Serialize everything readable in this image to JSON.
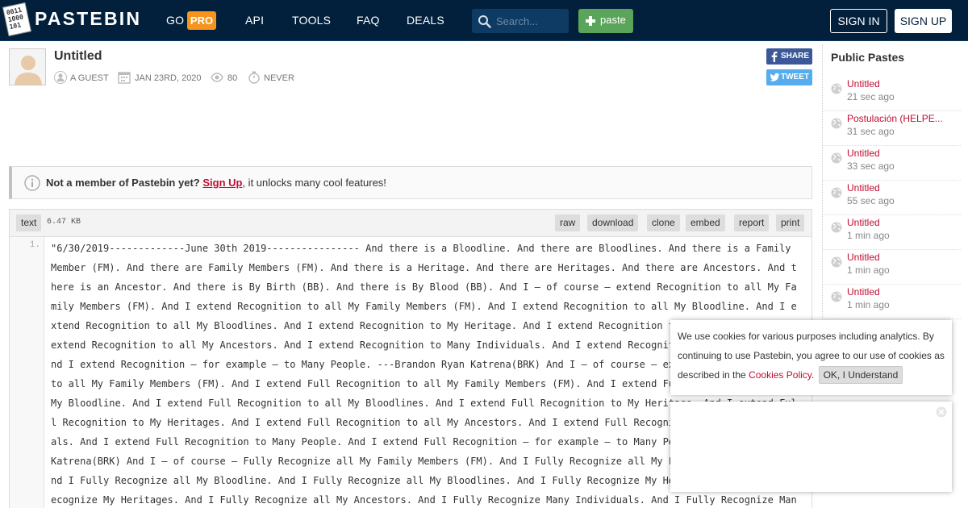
{
  "header": {
    "logo_text": "PASTEBIN",
    "nav": {
      "go": "GO",
      "pro": "PRO",
      "api": "API",
      "tools": "TOOLS",
      "faq": "FAQ",
      "deals": "DEALS"
    },
    "search_placeholder": "Search...",
    "paste_label": "paste",
    "sign_in": "SIGN IN",
    "sign_up": "SIGN UP"
  },
  "paste": {
    "title": "Untitled",
    "author": "A GUEST",
    "date": "JAN 23RD, 2020",
    "views": "80",
    "expiry": "NEVER",
    "share_label": "SHARE",
    "tweet_label": "TWEET"
  },
  "notice": {
    "bold": "Not a member of Pastebin yet?",
    "link": "Sign Up",
    "rest": ", it unlocks many cool features!"
  },
  "code": {
    "syntax": "text",
    "size": "6.47 KB",
    "buttons": {
      "raw": "raw",
      "download": "download",
      "clone": "clone",
      "embed": "embed",
      "report": "report",
      "print": "print"
    },
    "line_number": "1.",
    "content": "\"6/30/2019-------------June 30th 2019---------------- And there is a Bloodline. And there are Bloodlines. And there is a Family Member (FM). And there are Family Members (FM). And there is a Heritage. And there are Heritages. And there are Ancestors. And there is an Ancestor. And there is By Birth (BB). And there is By Blood (BB). And I – of course – extend Recognition to all My Family Members (FM). And I extend Recognition to all My Family Members (FM). And I extend Recognition to all My Bloodline. And I extend Recognition to all My Bloodlines. And I extend Recognition to My Heritage. And I extend Recognition to My Heritages. And I extend Recognition to all My Ancestors. And I extend Recognition to Many Individuals. And I extend Recognition to Many People. And I extend Recognition – for example – to Many People. ---Brandon Ryan Katrena(BRK) And I – of course – extend Full Recognition to all My Family Members (FM). And I extend Full Recognition to all My Family Members (FM). And I extend Full Recognition to all My Bloodline. And I extend Full Recognition to all My Bloodlines. And I extend Full Recognition to My Heritage. And I extend Full Recognition to My Heritages. And I extend Full Recognition to all My Ancestors. And I extend Full Recognition to Many Individuals. And I extend Full Recognition to Many People. And I extend Full Recognition – for example – to Many People.---Brandon Ryan Katrena(BRK) And I – of course – Fully Recognize all My Family Members (FM). And I Fully Recognize all My Family Members (FM). And I Fully Recognize all My Bloodline. And I Fully Recognize all My Bloodlines. And I Fully Recognize My Heritage. And I Fully Recognize My Heritages. And I Fully Recognize all My Ancestors. And I Fully Recognize Many Individuals. And I Fully Recognize Many People. And I Fully Recognize –"
  },
  "sidebar": {
    "title": "Public Pastes",
    "items": [
      {
        "title": "Untitled",
        "time": "21 sec ago"
      },
      {
        "title": "Postulación (HELPE...",
        "time": "31 sec ago"
      },
      {
        "title": "Untitled",
        "time": "33 sec ago"
      },
      {
        "title": "Untitled",
        "time": "55 sec ago"
      },
      {
        "title": "Untitled",
        "time": "1 min ago"
      },
      {
        "title": "Untitled",
        "time": "1 min ago"
      },
      {
        "title": "Untitled",
        "time": "1 min ago"
      }
    ]
  },
  "cookie": {
    "text": "We use cookies for various purposes including analytics. By continuing to use Pastebin, you agree to our use of cookies as described in the",
    "link": "Cookies Policy",
    "period": ".",
    "ok": "OK, I Understand"
  },
  "colors": {
    "header_bg": "#02203c",
    "accent_red": "#c20d30",
    "pro_orange": "#f7941d",
    "paste_green": "#5aa55a"
  }
}
